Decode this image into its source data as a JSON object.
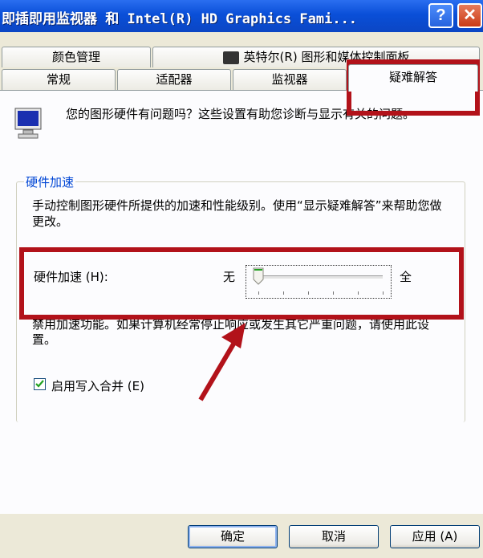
{
  "window": {
    "title": "即插即用监视器 和 Intel(R) HD Graphics Fami...",
    "help_glyph": "?",
    "close_glyph": "✕"
  },
  "tabs_row1": [
    {
      "label": "颜色管理"
    },
    {
      "label": "英特尔(R) 图形和媒体控制面板"
    }
  ],
  "tabs_row2": [
    {
      "label": "常规"
    },
    {
      "label": "适配器"
    },
    {
      "label": "监视器"
    },
    {
      "label": "疑难解答",
      "active": true
    }
  ],
  "panel": {
    "intro": "您的图形硬件有问题吗？这些设置有助您诊断与显示有关的问题。",
    "group_title": "硬件加速",
    "group_desc": "手动控制图形硬件所提供的加速和性能级别。使用“显示疑难解答”来帮助您做更改。",
    "accel_label": "硬件加速 (H):",
    "slider_min_label": "无",
    "slider_max_label": "全",
    "slider_level": 0,
    "warning": "禁用加速功能。如果计算机经常停止响应或发生其它严重问题，请使用此设置。",
    "write_combining_label": "启用写入合并 (E)",
    "write_combining_checked": true
  },
  "buttons": {
    "ok": "确定",
    "cancel": "取消",
    "apply": "应用 (A)"
  },
  "colors": {
    "annotation_red": "#b2121a",
    "titlebar_blue": "#0a4fd8"
  }
}
